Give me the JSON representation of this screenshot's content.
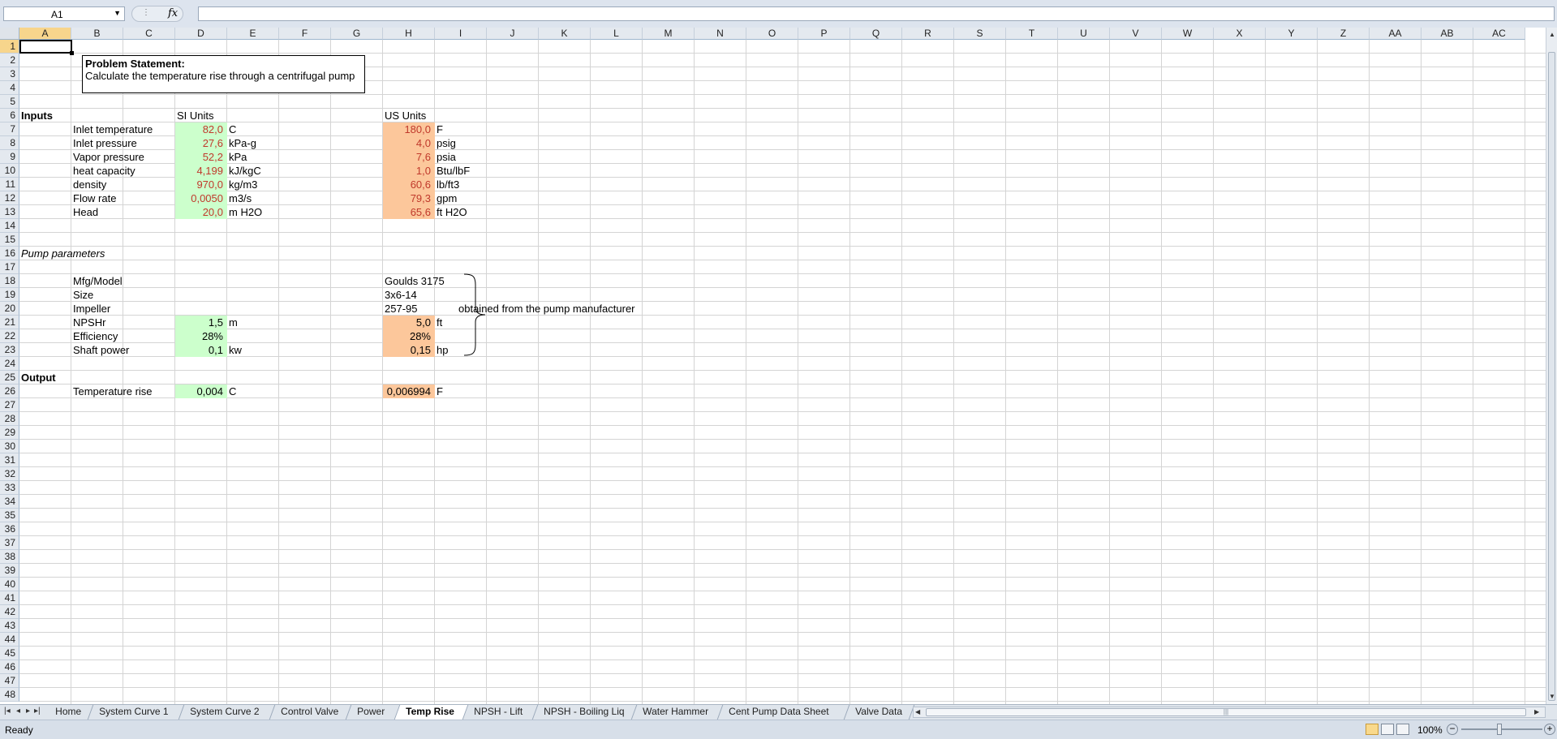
{
  "formula_bar": {
    "name_box": "A1",
    "fx_label": "fx",
    "formula": ""
  },
  "columns": [
    "A",
    "B",
    "C",
    "D",
    "E",
    "F",
    "G",
    "H",
    "I",
    "J",
    "K",
    "L",
    "M",
    "N",
    "O",
    "P",
    "Q",
    "R",
    "S",
    "T",
    "U",
    "V",
    "W",
    "X",
    "Y",
    "Z",
    "AA",
    "AB",
    "AC"
  ],
  "rows": [
    "1",
    "2",
    "3",
    "4",
    "5",
    "6",
    "7",
    "8",
    "9",
    "10",
    "11",
    "12",
    "13",
    "14",
    "15",
    "16",
    "17",
    "18",
    "19",
    "20",
    "21",
    "22",
    "23",
    "24",
    "25",
    "26",
    "27",
    "28",
    "29",
    "30",
    "31",
    "32",
    "33",
    "34",
    "35",
    "36",
    "37",
    "38",
    "39",
    "40",
    "41",
    "42",
    "43",
    "44",
    "45",
    "46",
    "47",
    "48"
  ],
  "problem": {
    "title": "Problem Statement:",
    "text": "Calculate the temperature rise through a centrifugal pump"
  },
  "inputs_label": "Inputs",
  "si_units_label": "SI Units",
  "us_units_label": "US Units",
  "inputs": [
    {
      "label": "Inlet temperature",
      "si_value": "82,0",
      "si_unit": "C",
      "us_value": "180,0",
      "us_unit": "F"
    },
    {
      "label": "Inlet pressure",
      "si_value": "27,6",
      "si_unit": "kPa-g",
      "us_value": "4,0",
      "us_unit": "psig"
    },
    {
      "label": "Vapor pressure",
      "si_value": "52,2",
      "si_unit": "kPa",
      "us_value": "7,6",
      "us_unit": "psia"
    },
    {
      "label": "heat capacity",
      "si_value": "4,199",
      "si_unit": "kJ/kgC",
      "us_value": "1,0",
      "us_unit": "Btu/lbF"
    },
    {
      "label": "density",
      "si_value": "970,0",
      "si_unit": "kg/m3",
      "us_value": "60,6",
      "us_unit": "lb/ft3"
    },
    {
      "label": "Flow rate",
      "si_value": "0,0050",
      "si_unit": "m3/s",
      "us_value": "79,3",
      "us_unit": "gpm"
    },
    {
      "label": "Head",
      "si_value": "20,0",
      "si_unit": "m H2O",
      "us_value": "65,6",
      "us_unit": "ft H2O"
    }
  ],
  "pump_label": "Pump parameters",
  "pump_info": [
    {
      "label": "Mfg/Model",
      "value": "Goulds 3175"
    },
    {
      "label": "Size",
      "value": "3x6-14"
    },
    {
      "label": "Impeller",
      "value": "257-95"
    }
  ],
  "pump_values": [
    {
      "label": "NPSHr",
      "si_value": "1,5",
      "si_unit": "m",
      "us_value": "5,0",
      "us_unit": "ft"
    },
    {
      "label": "Efficiency",
      "si_value": "28%",
      "si_unit": "",
      "us_value": "28%",
      "us_unit": ""
    },
    {
      "label": "Shaft power",
      "si_value": "0,1",
      "si_unit": "kw",
      "us_value": "0,15",
      "us_unit": "hp"
    }
  ],
  "manufacturer_note": "obtained from the pump manufacturer",
  "output_label": "Output",
  "output": {
    "label": "Temperature rise",
    "si_value": "0,004",
    "si_unit": "C",
    "us_value": "0,006994",
    "us_unit": "F"
  },
  "sheet_tabs": [
    "Home",
    "System Curve 1",
    "System Curve 2",
    "Control Valve",
    "Power",
    "Temp Rise",
    "NPSH - Lift",
    "NPSH - Boiling Liq",
    "Water Hammer",
    "Cent Pump Data Sheet",
    "Valve Data"
  ],
  "active_tab": "Temp Rise",
  "status": {
    "ready": "Ready",
    "zoom": "100%"
  },
  "colors": {
    "si_fill": "#ccffcc",
    "us_fill": "#fcc79b",
    "input_text": "#c0392b"
  }
}
